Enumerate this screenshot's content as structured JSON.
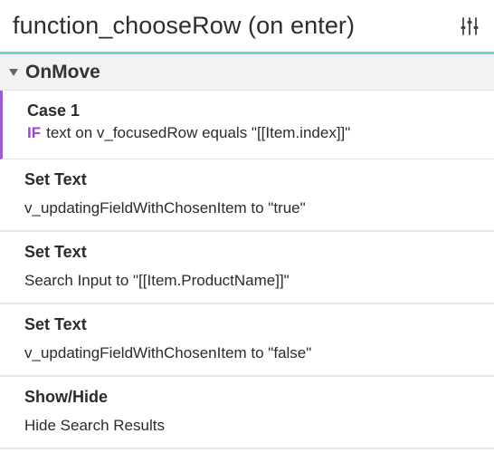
{
  "header": {
    "title": "function_chooseRow (on enter)",
    "settings_icon": "sliders-icon"
  },
  "event": {
    "name": "OnMove",
    "caret_icon": "caret-down-icon"
  },
  "case": {
    "title": "Case 1",
    "keyword": "IF",
    "condition": "text on v_focusedRow equals \"[[Item.index]]\""
  },
  "actions": [
    {
      "type": "Set Text",
      "detail": "v_updatingFieldWithChosenItem to \"true\""
    },
    {
      "type": "Set Text",
      "detail": "Search Input to \"[[Item.ProductName]]\""
    },
    {
      "type": "Set Text",
      "detail": "v_updatingFieldWithChosenItem to \"false\""
    },
    {
      "type": "Show/Hide",
      "detail": "Hide Search Results"
    }
  ],
  "colors": {
    "accent_teal": "#71d3cf",
    "case_purple": "#9b59d6",
    "if_keyword": "#9b43d9"
  }
}
